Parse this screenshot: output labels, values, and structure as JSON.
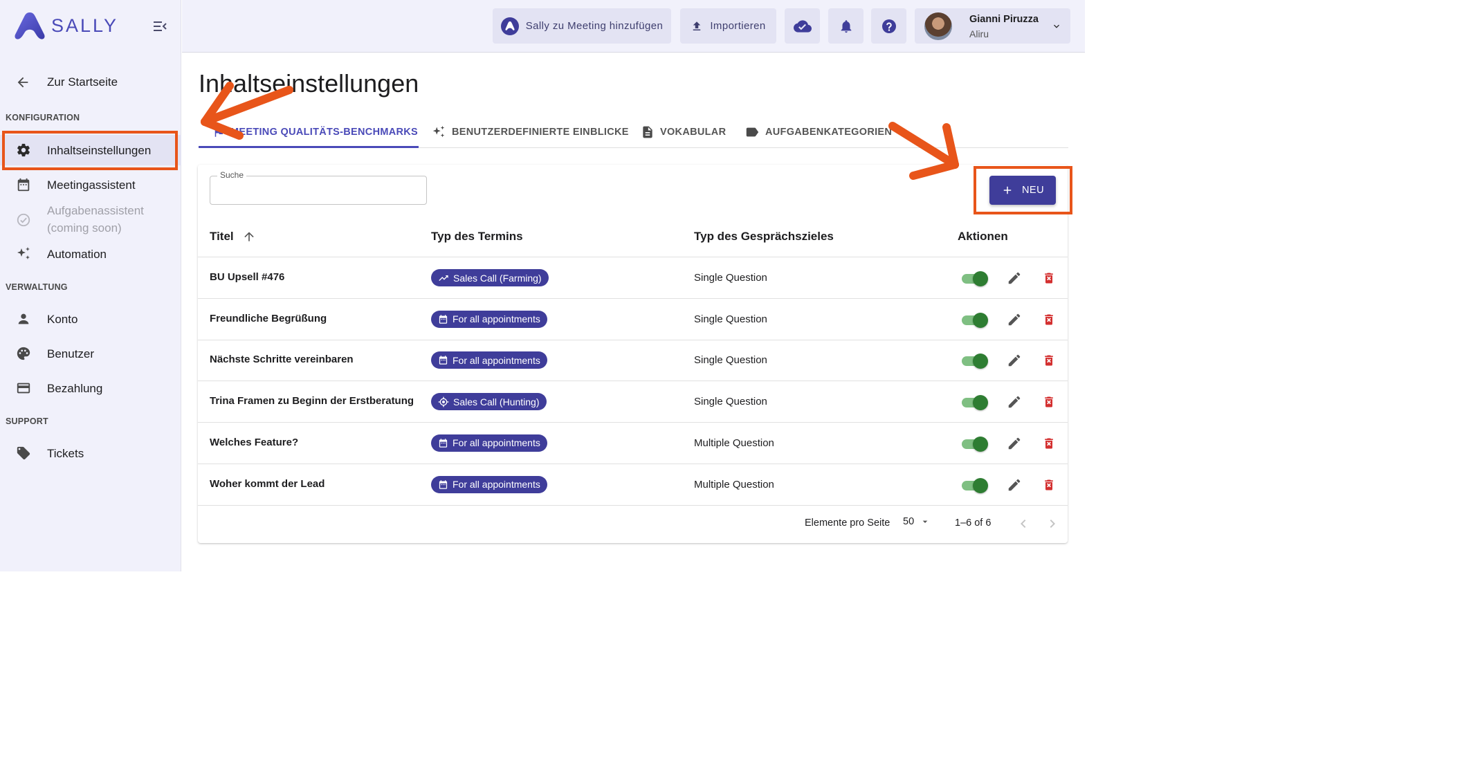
{
  "brand": {
    "name": "SALLY",
    "accent": "#4a4ab8",
    "button_dark": "#3f3d9a"
  },
  "sidebar": {
    "back_label": "Zur Startseite",
    "sections": [
      {
        "title": "KONFIGURATION"
      },
      {
        "title": "VERWALTUNG"
      },
      {
        "title": "SUPPORT"
      }
    ],
    "items": [
      {
        "label": "Inhaltseinstellungen",
        "icon": "gear-icon",
        "active": true
      },
      {
        "label": "Meetingassistent",
        "icon": "calendar-icon"
      },
      {
        "label": "Aufgabenassistent (coming soon)",
        "label_line1": "Aufgabenassistent",
        "label_line2": "(coming soon)",
        "icon": "check-circle-icon",
        "disabled": true
      },
      {
        "label": "Automation",
        "icon": "sparkle-icon"
      },
      {
        "label": "Konto",
        "icon": "person-icon"
      },
      {
        "label": "Benutzer",
        "icon": "palette-icon"
      },
      {
        "label": "Bezahlung",
        "icon": "credit-card-icon"
      },
      {
        "label": "Tickets",
        "icon": "tag-icon"
      }
    ]
  },
  "topbar": {
    "add_to_meeting_label": "Sally zu Meeting hinzufügen",
    "import_label": "Importieren",
    "user": {
      "name": "Gianni Piruzza",
      "org": "Aliru"
    }
  },
  "main": {
    "title": "Inhaltseinstellungen",
    "tabs": [
      {
        "label": "MEETING QUALITÄTS-BENCHMARKS",
        "icon": "flag-icon",
        "active": true
      },
      {
        "label": "BENUTZERDEFINIERTE EINBLICKE",
        "icon": "sparkle-icon"
      },
      {
        "label": "VOKABULAR",
        "icon": "document-icon"
      },
      {
        "label": "AUFGABENKATEGORIEN",
        "icon": "label-icon"
      }
    ],
    "search": {
      "label": "Suche",
      "value": "",
      "placeholder": ""
    },
    "new_button_label": "NEU",
    "table": {
      "headers": [
        "Titel",
        "Typ des Termins",
        "Typ des Gesprächszieles",
        "Aktionen"
      ],
      "sort": {
        "column": "Titel",
        "direction": "ascending"
      },
      "rows": [
        {
          "title": "BU Upsell #476",
          "type": "Sales Call (Farming)",
          "type_icon": "trending-up-icon",
          "goal": "Single Question",
          "enabled": true
        },
        {
          "title": "Freundliche Begrüßung",
          "type": "For all appointments",
          "type_icon": "calendar-icon",
          "goal": "Single Question",
          "enabled": true
        },
        {
          "title": "Nächste Schritte vereinbaren",
          "type": "For all appointments",
          "type_icon": "calendar-icon",
          "goal": "Single Question",
          "enabled": true
        },
        {
          "title": "Trina Framen zu Beginn der Erstberatung",
          "type": "Sales Call (Hunting)",
          "type_icon": "target-icon",
          "goal": "Single Question",
          "enabled": true
        },
        {
          "title": "Welches Feature?",
          "type": "For all appointments",
          "type_icon": "calendar-icon",
          "goal": "Multiple Question",
          "enabled": true
        },
        {
          "title": "Woher kommt der Lead",
          "type": "For all appointments",
          "type_icon": "calendar-icon",
          "goal": "Multiple Question",
          "enabled": true
        }
      ]
    },
    "pagination": {
      "rows_per_page_label": "Elemente pro Seite",
      "rows_per_page": "50",
      "range": "1–6 of 6"
    }
  },
  "annotations": {
    "color": "#e8551a"
  }
}
